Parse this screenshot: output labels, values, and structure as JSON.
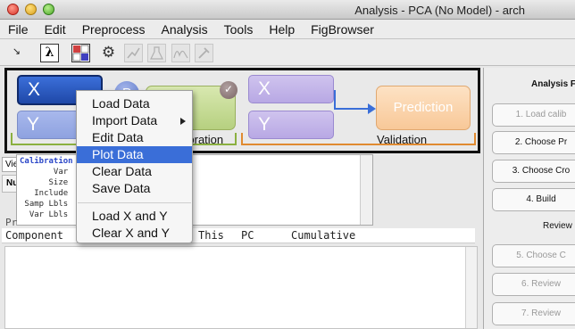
{
  "window": {
    "title": "Analysis - PCA (No Model) - arch",
    "title_ghost": "..."
  },
  "menubar": [
    "File",
    "Edit",
    "Preprocess",
    "Analysis",
    "Tools",
    "Help",
    "FigBrowser"
  ],
  "toolbar": {
    "arrow": "↘",
    "lambda": "λ",
    "matrix": "A B\nC D",
    "gears": "⚙"
  },
  "workflow": {
    "x_label": "X",
    "y_label": "Y",
    "p_circle": "P",
    "check": "✓",
    "calibration_label": "Calibration",
    "val_x_label": "X",
    "val_y_label": "Y",
    "prediction_label": "Prediction",
    "validation_label": "Validation"
  },
  "info_panel": {
    "view_tab": "View",
    "num_header": "Nu",
    "lines": [
      "Calibration",
      "       Var",
      "      Size",
      "   Include",
      " Samp Lbls",
      "  Var Lbls"
    ],
    "fragment": "Pr"
  },
  "table_header": {
    "component": "Component",
    "this": "This",
    "pc": "PC",
    "cumulative": "Cumulative"
  },
  "right_panel": {
    "title": "Analysis F",
    "buttons": [
      {
        "label": "1. Load calib",
        "enabled": false
      },
      {
        "label": "2. Choose Pr",
        "enabled": true
      },
      {
        "label": "3. Choose Cro",
        "enabled": true
      },
      {
        "label": "4. Build",
        "enabled": true
      },
      {
        "label": "Review",
        "enabled": true
      },
      {
        "label": "5. Choose C",
        "enabled": false
      },
      {
        "label": "6. Review",
        "enabled": false
      },
      {
        "label": "7. Review",
        "enabled": false
      }
    ]
  },
  "context_menu": {
    "items": [
      {
        "label": "Load Data"
      },
      {
        "label": "Import Data",
        "submenu": true
      },
      {
        "label": "Edit Data"
      },
      {
        "label": "Plot Data",
        "highlighted": true
      },
      {
        "label": "Clear Data"
      },
      {
        "label": "Save Data"
      },
      {
        "label": "Load X and Y"
      },
      {
        "label": "Clear X and Y"
      }
    ]
  },
  "colors": {
    "highlight": "#3a6ed8",
    "x_block": "#1f48a8",
    "calibration_bracket": "#8bb040",
    "validation_bracket": "#e08a30",
    "prediction": "#f8c898"
  }
}
